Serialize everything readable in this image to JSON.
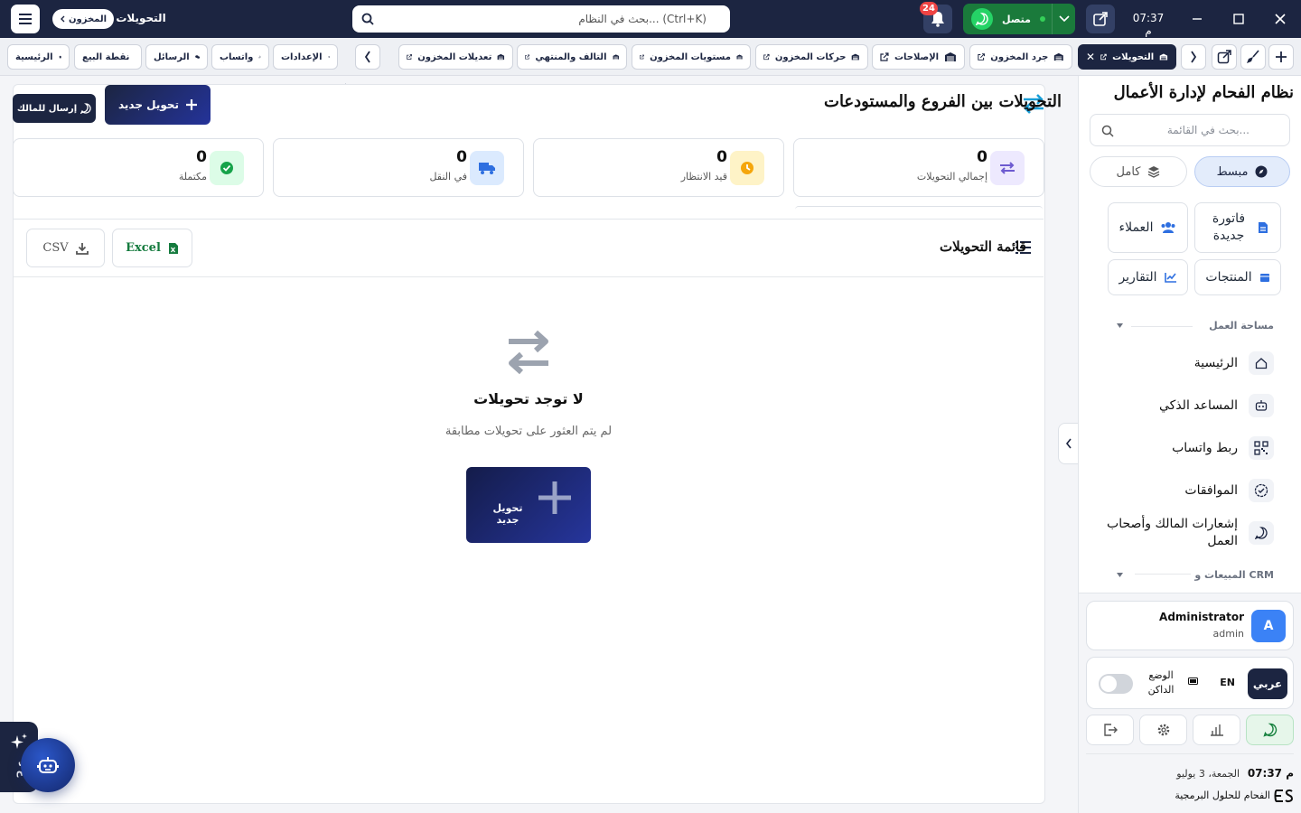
{
  "window": {
    "clock": "07:37 م",
    "page_title": "التحويلات",
    "breadcrumb": "المخزون",
    "search_placeholder": "بحث في النظام... (Ctrl+K)",
    "whatsapp_status": "متصل",
    "notifications_count": "24"
  },
  "tabs": [
    {
      "label": "التحويلات",
      "active": true
    },
    {
      "label": "جرد المخزون"
    },
    {
      "label": "الإصلاحات"
    },
    {
      "label": "حركات المخزون"
    },
    {
      "label": "مستويات المخزون"
    },
    {
      "label": "التالف والمنتهي"
    },
    {
      "label": "تعديلات المخزون"
    }
  ],
  "quick_links": [
    {
      "label": "الإعدادات",
      "icon": "gear-icon"
    },
    {
      "label": "واتساب",
      "icon": "whatsapp-icon"
    },
    {
      "label": "الرسائل",
      "icon": "chat-icon"
    },
    {
      "label": "نقطة البيع",
      "icon": "register-icon"
    },
    {
      "label": "الرئيسية",
      "icon": "home-icon"
    }
  ],
  "main": {
    "title": "التحويلات بين الفروع والمستودعات",
    "new_transfer_label": "تحويل جديد",
    "send_owner_label": "إرسال للمالك",
    "stats": [
      {
        "label": "إجمالي التحويلات",
        "value": "0",
        "icon": "swap-icon",
        "color": "#ede9fe"
      },
      {
        "label": "قيد الانتظار",
        "value": "0",
        "icon": "clock-icon",
        "color": "#fef3c7"
      },
      {
        "label": "في النقل",
        "value": "0",
        "icon": "truck-icon",
        "color": "#dbeafe"
      },
      {
        "label": "مكتملة",
        "value": "0",
        "icon": "check-icon",
        "color": "#dcfce7"
      }
    ],
    "list_title": "قائمة التحويلات",
    "export_excel": "Excel",
    "export_csv": "CSV",
    "empty_title": "لا توجد تحويلات",
    "empty_subtitle": "لم يتم العثور على تحويلات مطابقة",
    "empty_button": "تحويل جديد"
  },
  "sidebar": {
    "brand": "نظام الفحام لإدارة الأعمال",
    "search_placeholder": "بحث في القائمة...",
    "mode_simple": "مبسط",
    "mode_full": "كامل",
    "quick": {
      "new_invoice": "فاتورة جديدة",
      "customers": "العملاء",
      "products": "المنتجات",
      "reports": "التقارير"
    },
    "section_workspace": "مساحة العمل",
    "nav": [
      {
        "label": "الرئيسية",
        "icon": "home-icon"
      },
      {
        "label": "المساعد الذكي",
        "icon": "robot-icon"
      },
      {
        "label": "ربط واتساب",
        "icon": "qr-icon"
      },
      {
        "label": "الموافقات",
        "icon": "badge-check-icon"
      },
      {
        "label": "إشعارات المالك وأصحاب العمل",
        "icon": "whatsapp-icon"
      }
    ],
    "section_sales": "المبيعات و CRM",
    "user": {
      "initial": "A",
      "name": "Administrator",
      "role": "admin"
    },
    "lang_ar": "عربي",
    "lang_en": "EN",
    "dark_mode": "الوضع الداكن",
    "time": "07:37 م",
    "date": "الجمعة، 3 يوليو",
    "company": "الفحام للحلول البرمجية"
  },
  "ai": {
    "label": "ع ذ"
  }
}
